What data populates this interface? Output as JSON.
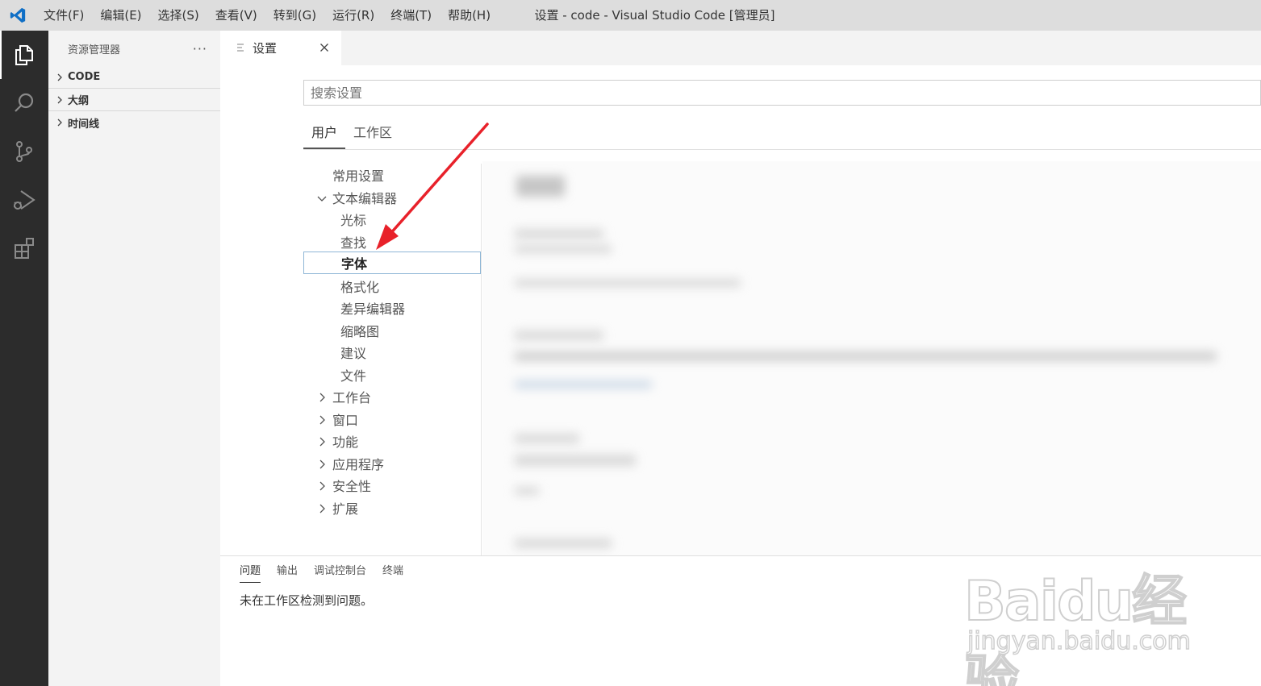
{
  "titlebar": {
    "menu": [
      "文件(F)",
      "编辑(E)",
      "选择(S)",
      "查看(V)",
      "转到(G)",
      "运行(R)",
      "终端(T)",
      "帮助(H)"
    ],
    "title": "设置 - code - Visual Studio Code [管理员]"
  },
  "activitybar": {
    "icons": [
      "explorer-icon",
      "search-icon",
      "source-control-icon",
      "run-debug-icon",
      "extensions-icon"
    ]
  },
  "sidebar": {
    "title": "资源管理器",
    "more": "···",
    "sections": [
      "CODE",
      "大纲",
      "时间线"
    ]
  },
  "tab": {
    "label": "设置"
  },
  "settings": {
    "search_placeholder": "搜索设置",
    "scope_tabs": [
      "用户",
      "工作区"
    ],
    "toc": [
      {
        "label": "常用设置",
        "level": 0,
        "chevron": "none"
      },
      {
        "label": "文本编辑器",
        "level": 0,
        "chevron": "down"
      },
      {
        "label": "光标",
        "level": 1,
        "chevron": "none"
      },
      {
        "label": "查找",
        "level": 1,
        "chevron": "none"
      },
      {
        "label": "字体",
        "level": 1,
        "chevron": "none",
        "selected": true
      },
      {
        "label": "格式化",
        "level": 1,
        "chevron": "none"
      },
      {
        "label": "差异编辑器",
        "level": 1,
        "chevron": "none"
      },
      {
        "label": "缩略图",
        "level": 1,
        "chevron": "none"
      },
      {
        "label": "建议",
        "level": 1,
        "chevron": "none"
      },
      {
        "label": "文件",
        "level": 1,
        "chevron": "none"
      },
      {
        "label": "工作台",
        "level": 0,
        "chevron": "right"
      },
      {
        "label": "窗口",
        "level": 0,
        "chevron": "right"
      },
      {
        "label": "功能",
        "level": 0,
        "chevron": "right"
      },
      {
        "label": "应用程序",
        "level": 0,
        "chevron": "right"
      },
      {
        "label": "安全性",
        "level": 0,
        "chevron": "right"
      },
      {
        "label": "扩展",
        "level": 0,
        "chevron": "right"
      }
    ]
  },
  "panel": {
    "tabs": [
      "问题",
      "输出",
      "调试控制台",
      "终端"
    ],
    "message": "未在工作区检测到问题。"
  },
  "watermark": {
    "brand": "Baidu经验",
    "url": "jingyan.baidu.com"
  },
  "colors": {
    "accent": "#e8212a",
    "activity_bg": "#2c2c2c",
    "vscode_blue": "#0f6fc6"
  }
}
